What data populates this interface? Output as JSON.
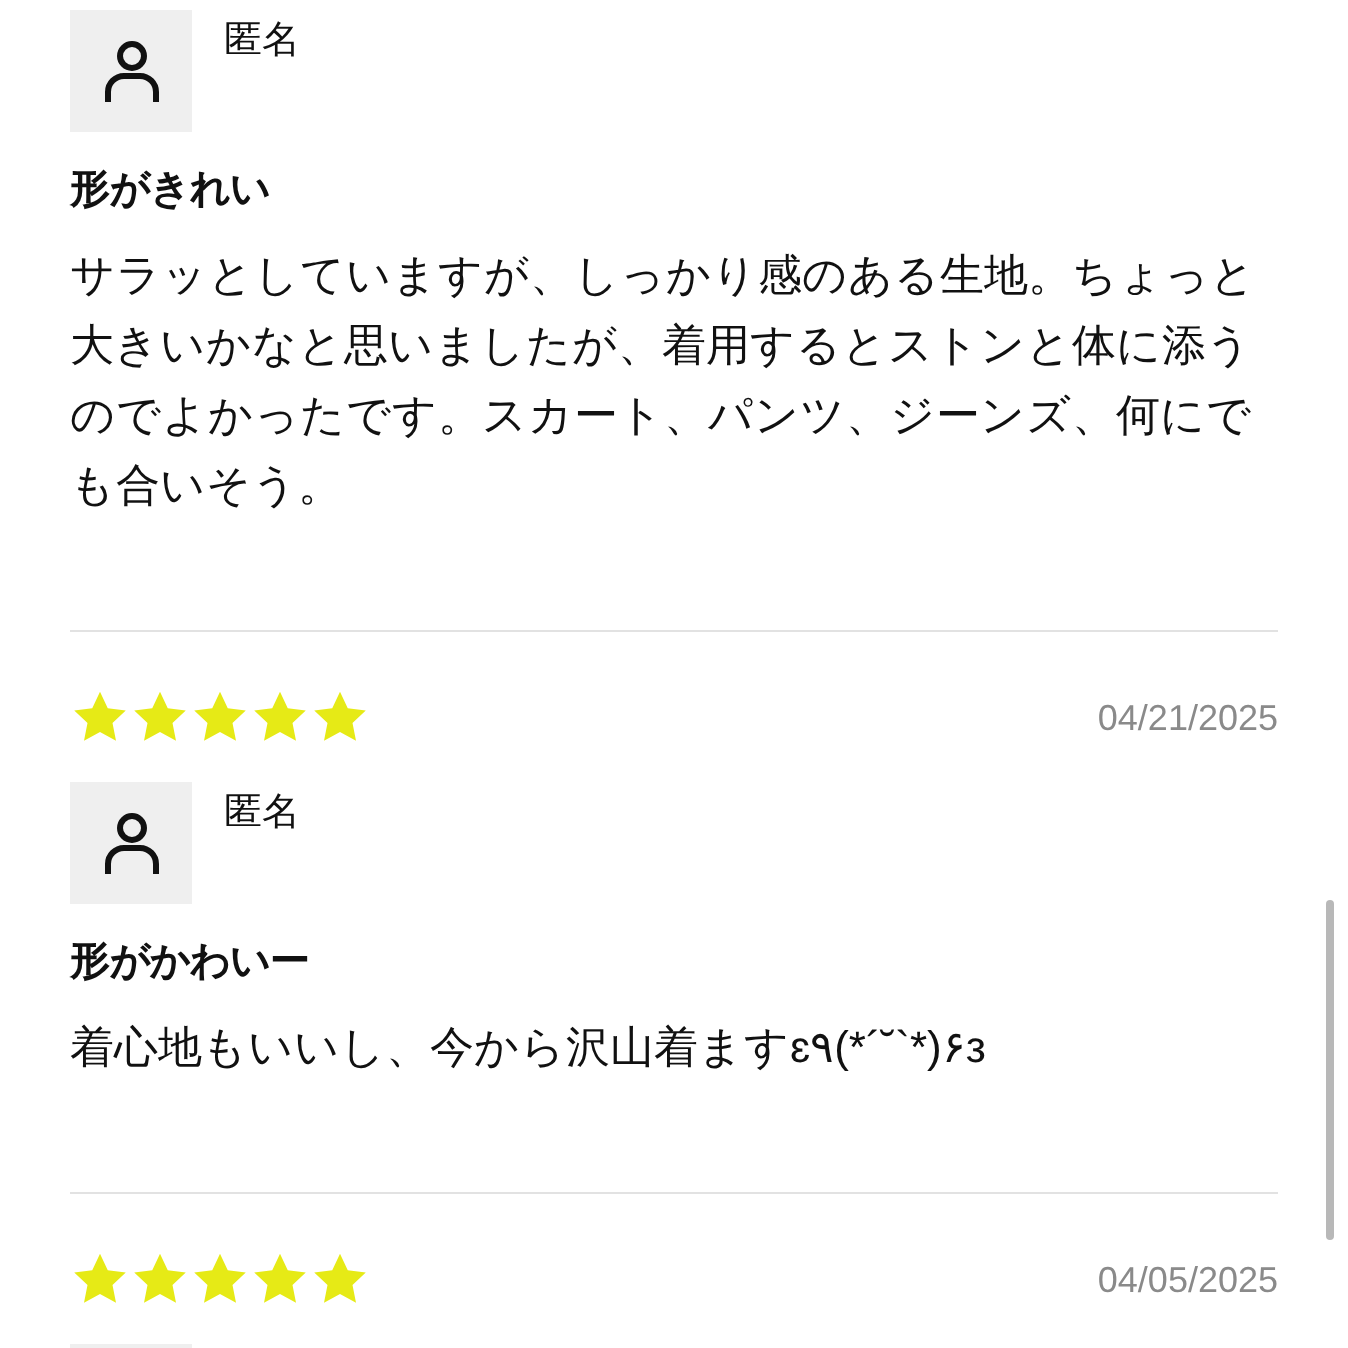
{
  "reviews": [
    {
      "name": "匿名",
      "title": "形がきれい",
      "body": "サラッとしていますが、しっかり感のある生地。ちょっと大きいかなと思いましたが、着用するとストンと体に添うのでよかったです。スカート、パンツ、ジーンズ、何にでも合いそう。"
    },
    {
      "stars": 5,
      "date": "04/21/2025",
      "name": "匿名",
      "title": "形がかわいー",
      "body": "着心地もいいし、今から沢山着ますɛ٩(*´˘`*)۶з"
    },
    {
      "stars": 5,
      "date": "04/05/2025"
    }
  ]
}
